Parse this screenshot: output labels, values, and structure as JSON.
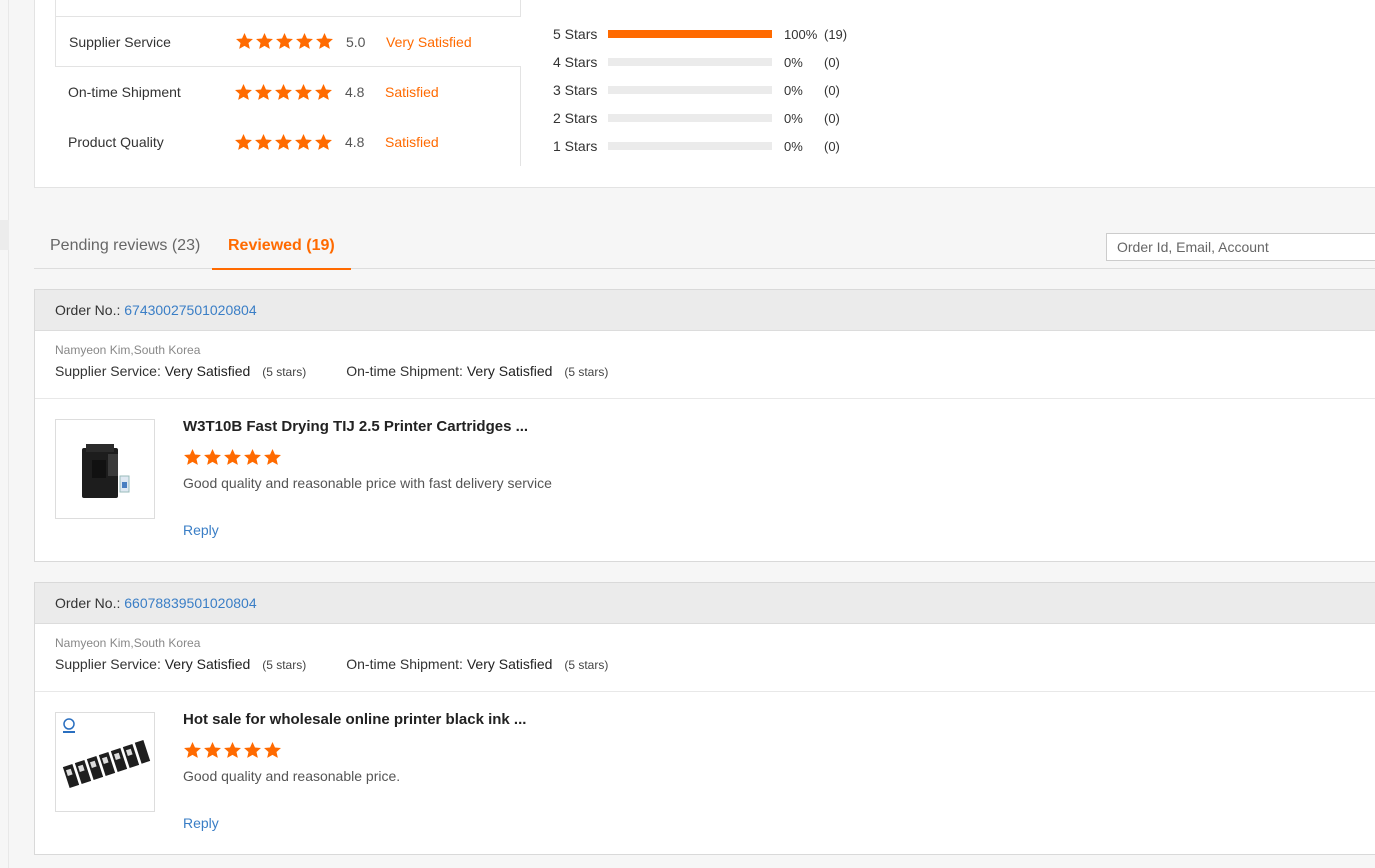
{
  "summary": {
    "ratings": [
      {
        "label": "Supplier Service",
        "score": "5.0",
        "verdict": "Very Satisfied"
      },
      {
        "label": "On-time Shipment",
        "score": "4.8",
        "verdict": "Satisfied"
      },
      {
        "label": "Product Quality",
        "score": "4.8",
        "verdict": "Satisfied"
      }
    ],
    "distribution": [
      {
        "label": "5 Stars",
        "pct": "100%",
        "count": "(19)",
        "fraction": 1.0
      },
      {
        "label": "4 Stars",
        "pct": "0%",
        "count": "(0)",
        "fraction": 0
      },
      {
        "label": "3 Stars",
        "pct": "0%",
        "count": "(0)",
        "fraction": 0
      },
      {
        "label": "2 Stars",
        "pct": "0%",
        "count": "(0)",
        "fraction": 0
      },
      {
        "label": "1 Stars",
        "pct": "0%",
        "count": "(0)",
        "fraction": 0
      }
    ]
  },
  "tabs": {
    "pending": "Pending reviews (23)",
    "reviewed": "Reviewed (19)"
  },
  "search": {
    "placeholder": "Order Id, Email, Account"
  },
  "accent_color": "#ff6a00",
  "link_color": "#3a7ec6",
  "orders": [
    {
      "order_label": "Order No.:",
      "order_no": "67430027501020804",
      "buyer": "Namyeon Kim,South Korea",
      "supplier_label": "Supplier Service:",
      "supplier_value": "Very Satisfied",
      "supplier_stars": "(5 stars)",
      "shipment_label": "On-time Shipment:",
      "shipment_value": "Very Satisfied",
      "shipment_stars": "(5 stars)",
      "product_title": "W3T10B Fast Drying TIJ 2.5 Printer Cartridges ...",
      "product_rating": 5,
      "review": "Good quality and reasonable price with fast delivery service",
      "reply": "Reply"
    },
    {
      "order_label": "Order No.:",
      "order_no": "66078839501020804",
      "buyer": "Namyeon Kim,South Korea",
      "supplier_label": "Supplier Service:",
      "supplier_value": "Very Satisfied",
      "supplier_stars": "(5 stars)",
      "shipment_label": "On-time Shipment:",
      "shipment_value": "Very Satisfied",
      "shipment_stars": "(5 stars)",
      "product_title": "Hot sale for wholesale online printer black ink ...",
      "product_rating": 5,
      "review": "Good quality and reasonable price.",
      "reply": "Reply"
    }
  ]
}
